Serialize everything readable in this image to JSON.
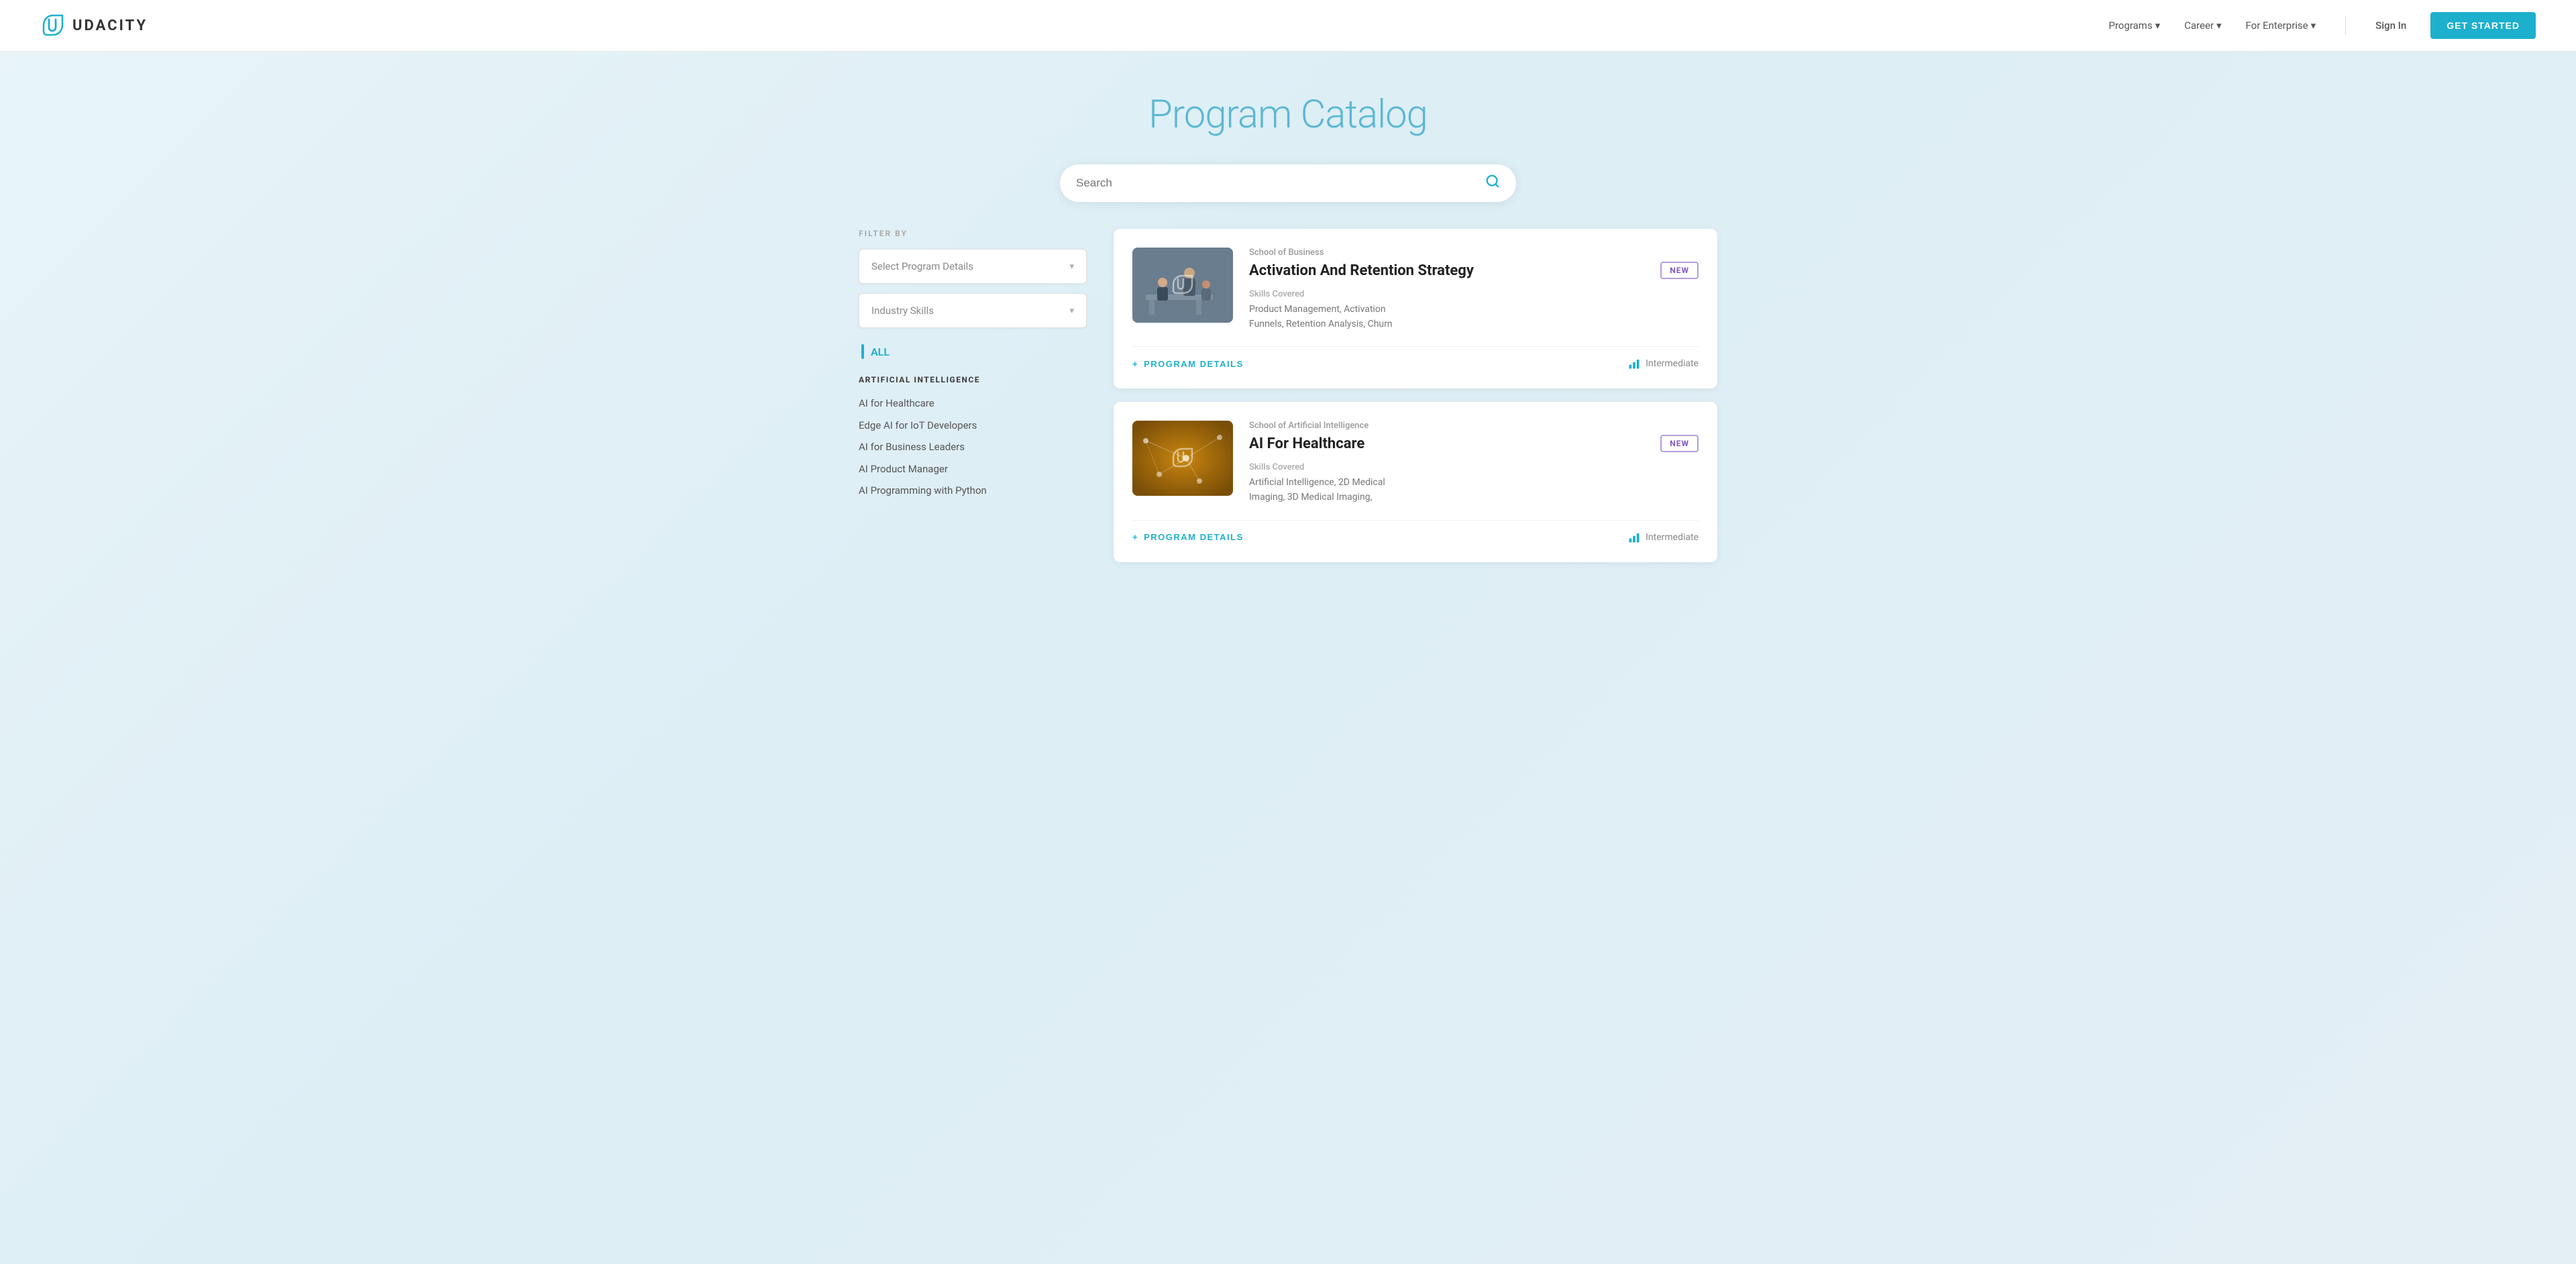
{
  "nav": {
    "logo_text": "UDACITY",
    "links": [
      {
        "label": "Programs",
        "has_dropdown": true
      },
      {
        "label": "Career",
        "has_dropdown": true
      },
      {
        "label": "For Enterprise",
        "has_dropdown": true
      }
    ],
    "sign_in": "Sign In",
    "get_started": "GET STARTED"
  },
  "hero": {
    "title": "Program Catalog"
  },
  "search": {
    "placeholder": "Search"
  },
  "filters": {
    "label": "FILTER BY",
    "program_details": "Select Program Details",
    "industry_skills": "Industry Skills"
  },
  "sidebar": {
    "all_label": "ALL",
    "categories": [
      {
        "heading": "ARTIFICIAL INTELLIGENCE",
        "items": [
          "AI for Healthcare",
          "Edge AI for IoT Developers",
          "AI for Business Leaders",
          "AI Product Manager",
          "AI Programming with Python"
        ]
      }
    ]
  },
  "cards": [
    {
      "school": "School of Business",
      "title": "Activation And Retention Strategy",
      "is_new": true,
      "new_label": "NEW",
      "skills_label": "Skills Covered",
      "skills": "Product Management, Activation\nFunnels, Retention Analysis, Churn",
      "details_label": "PROGRAM DETAILS",
      "difficulty": "Intermediate",
      "thumbnail_type": "business"
    },
    {
      "school": "School of Artificial Intelligence",
      "title": "AI For Healthcare",
      "is_new": true,
      "new_label": "NEW",
      "skills_label": "Skills Covered",
      "skills": "Artificial Intelligence, 2D Medical\nImaging, 3D Medical Imaging,",
      "details_label": "PROGRAM DETAILS",
      "difficulty": "Intermediate",
      "thumbnail_type": "ai"
    }
  ]
}
